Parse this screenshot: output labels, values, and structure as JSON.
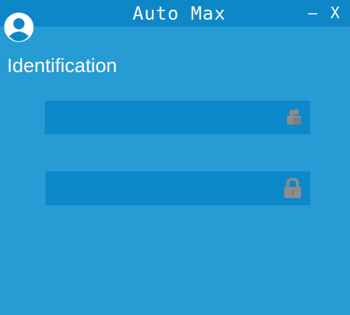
{
  "window": {
    "title": "Auto Max",
    "minimize_label": "—",
    "close_label": "X"
  },
  "heading": "Identification",
  "fields": {
    "username": {
      "value": "",
      "placeholder": "",
      "icon": "users-icon"
    },
    "password": {
      "value": "",
      "placeholder": "",
      "icon": "lock-icon"
    }
  },
  "colors": {
    "background": "#279bd4",
    "titlebar": "#0e87c9",
    "field": "#0d88c9",
    "icon": "#8c8c8c",
    "text": "#ffffff"
  }
}
